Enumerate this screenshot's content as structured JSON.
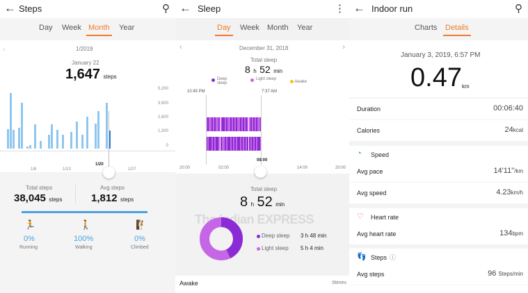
{
  "colors": {
    "accent": "#f07a2b",
    "steps_blue": "#4aa3e0",
    "deep_sleep": "#8a2bd6",
    "light_sleep": "#c566e6",
    "awake": "#f5c518"
  },
  "steps": {
    "title": "Steps",
    "tabs": [
      "Day",
      "Week",
      "Month",
      "Year"
    ],
    "active_tab": "Month",
    "period": "1/2019",
    "selected_date": "January 22",
    "selected_value": "1,647",
    "selected_unit": "steps",
    "y_ticks": [
      "5,200",
      "3,900",
      "2,600",
      "1,300",
      "0"
    ],
    "x_ticks": [
      "1/6",
      "1/13",
      "1/20",
      "1/27"
    ],
    "chart_data": {
      "type": "bar",
      "values": [
        1800,
        5100,
        1700,
        0,
        1900,
        4200,
        0,
        200,
        300,
        0,
        2200,
        0,
        700,
        0,
        0,
        1300,
        2200,
        0,
        1700,
        0,
        1300,
        0,
        0,
        1500,
        0,
        2500,
        0,
        1300,
        0,
        2900,
        0,
        0,
        2300,
        3400,
        0,
        0,
        4200,
        1647
      ],
      "ylim": [
        0,
        5200
      ]
    },
    "total_label": "Total steps",
    "total_value": "38,045",
    "total_unit": "steps",
    "avg_label": "Avg steps",
    "avg_value": "1,812",
    "avg_unit": "steps",
    "activities": [
      {
        "icon": "running-icon",
        "glyph": "🏃",
        "pct": "0%",
        "label": "Running"
      },
      {
        "icon": "walking-icon",
        "glyph": "🚶",
        "pct": "100%",
        "label": "Walking"
      },
      {
        "icon": "climbing-icon",
        "glyph": "🧗",
        "pct": "0%",
        "label": "Climbed"
      }
    ]
  },
  "sleep": {
    "title": "Sleep",
    "tabs": [
      "Day",
      "Week",
      "Month",
      "Year"
    ],
    "active_tab": "Day",
    "date": "December 31, 2018",
    "total_label": "Total sleep",
    "hours": "8",
    "h": "h",
    "minutes": "52",
    "min": "min",
    "legend": [
      "Deep sleep",
      "Light sleep",
      "Awake"
    ],
    "start_time": "10:45 PM",
    "end_time": "7:37 AM",
    "x_ticks": [
      "20:00",
      "02:00",
      "08:00",
      "14:00",
      "20:00"
    ],
    "deep_label": "Deep sleep",
    "deep_value": "3 h 48 min",
    "light_label": "Light sleep",
    "light_value": "5 h 4 min",
    "awake_label": "Awake",
    "awake_value": "0times",
    "watermark": "The Indian EXPRESS"
  },
  "run": {
    "title": "Indoor run",
    "tabs": [
      "Charts",
      "Details"
    ],
    "active_tab": "Details",
    "datetime": "January 3, 2019, 6:57 PM",
    "distance": "0.47",
    "distance_unit": "km",
    "duration_label": "Duration",
    "duration_value": "00:06:40",
    "calories_label": "Calories",
    "calories_value": "24",
    "calories_unit": "kcal",
    "speed_section": "Speed",
    "avg_pace_label": "Avg pace",
    "avg_pace_value": "14'11\"",
    "avg_pace_unit": "/km",
    "avg_speed_label": "Avg speed",
    "avg_speed_value": "4.23",
    "avg_speed_unit": "km/h",
    "hr_section": "Heart rate",
    "avg_hr_label": "Avg heart rate",
    "avg_hr_value": "134",
    "avg_hr_unit": "bpm",
    "steps_section": "Steps",
    "avg_steps_label": "Avg steps",
    "avg_steps_value": "96",
    "avg_steps_unit": "Steps/min"
  }
}
